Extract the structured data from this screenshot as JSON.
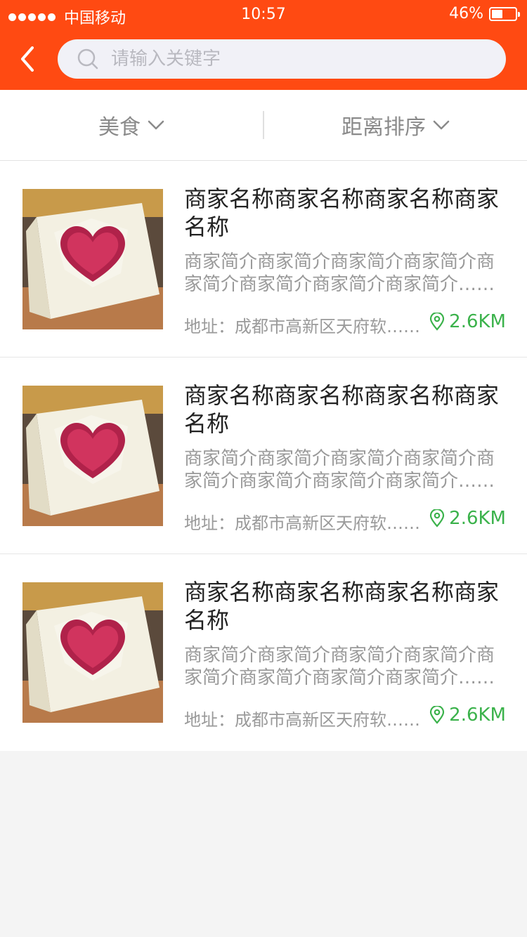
{
  "status_bar": {
    "carrier": "中国移动",
    "time": "10:57",
    "battery": "46%",
    "battery_level": 0.46
  },
  "header": {
    "back_icon": "chevron-left-icon",
    "search": {
      "placeholder": "请输入关键字",
      "value": "",
      "icon": "search-icon"
    }
  },
  "filters": {
    "category": {
      "label": "美食",
      "icon": "chevron-down-icon"
    },
    "sort": {
      "label": "距离排序",
      "icon": "chevron-down-icon"
    }
  },
  "colors": {
    "brand": "#ff4a12",
    "distance": "#3bb24b",
    "text_primary": "#222222",
    "text_secondary": "#9a9a9a"
  },
  "merchants": [
    {
      "name": "商家名称商家名称商家名称商家名称",
      "intro": "商家简介商家简介商家简介商家简介商家简介商家简介商家简介商家简介……",
      "address": "地址：成都市高新区天府软……",
      "distance": "2.6KM",
      "image": "heart-cake-photo"
    },
    {
      "name": "商家名称商家名称商家名称商家名称",
      "intro": "商家简介商家简介商家简介商家简介商家简介商家简介商家简介商家简介……",
      "address": "地址：成都市高新区天府软……",
      "distance": "2.6KM",
      "image": "heart-cake-photo"
    },
    {
      "name": "商家名称商家名称商家名称商家名称",
      "intro": "商家简介商家简介商家简介商家简介商家简介商家简介商家简介商家简介……",
      "address": "地址：成都市高新区天府软……",
      "distance": "2.6KM",
      "image": "heart-cake-photo"
    }
  ]
}
